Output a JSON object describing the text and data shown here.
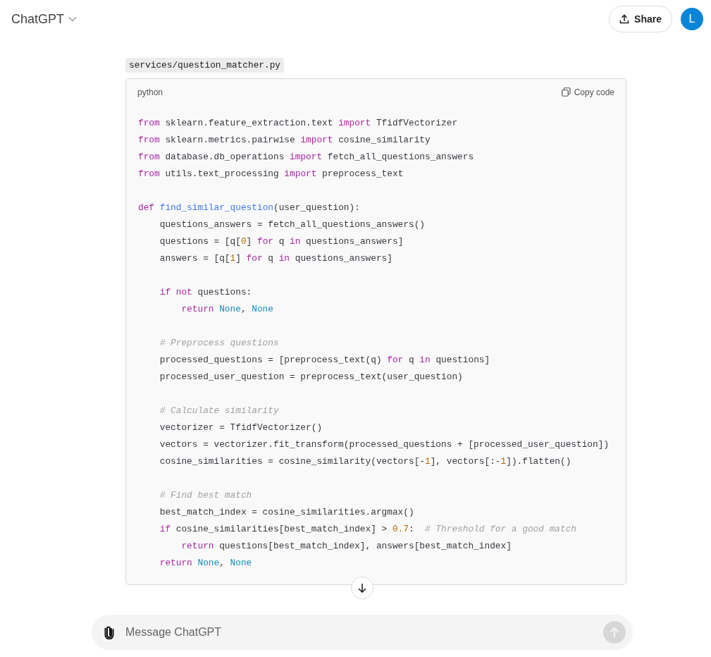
{
  "header": {
    "title": "ChatGPT",
    "share_label": "Share",
    "avatar_letter": "L"
  },
  "file_label": "services/question_matcher.py",
  "code_block": {
    "language": "python",
    "copy_label": "Copy code",
    "lines": [
      {
        "kind": "code",
        "tokens": [
          {
            "kind": "keyword",
            "text": "from"
          },
          {
            "kind": "plain",
            "text": " sklearn.feature_extraction.text "
          },
          {
            "kind": "keyword",
            "text": "import"
          },
          {
            "kind": "plain",
            "text": " TfidfVectorizer"
          }
        ]
      },
      {
        "kind": "code",
        "tokens": [
          {
            "kind": "keyword",
            "text": "from"
          },
          {
            "kind": "plain",
            "text": " sklearn.metrics.pairwise "
          },
          {
            "kind": "keyword",
            "text": "import"
          },
          {
            "kind": "plain",
            "text": " cosine_similarity"
          }
        ]
      },
      {
        "kind": "code",
        "tokens": [
          {
            "kind": "keyword",
            "text": "from"
          },
          {
            "kind": "plain",
            "text": " database.db_operations "
          },
          {
            "kind": "keyword",
            "text": "import"
          },
          {
            "kind": "plain",
            "text": " fetch_all_questions_answers"
          }
        ]
      },
      {
        "kind": "code",
        "tokens": [
          {
            "kind": "keyword",
            "text": "from"
          },
          {
            "kind": "plain",
            "text": " utils.text_processing "
          },
          {
            "kind": "keyword",
            "text": "import"
          },
          {
            "kind": "plain",
            "text": " preprocess_text"
          }
        ]
      },
      {
        "kind": "blank"
      },
      {
        "kind": "code",
        "tokens": [
          {
            "kind": "keyword",
            "text": "def "
          },
          {
            "kind": "function",
            "text": "find_similar_question"
          },
          {
            "kind": "plain",
            "text": "(user_question):"
          }
        ],
        "children": [
          {
            "kind": "code",
            "tokens": [
              {
                "kind": "plain",
                "text": "questions_answers = fetch_all_questions_answers()"
              }
            ]
          },
          {
            "kind": "code",
            "tokens": [
              {
                "kind": "plain",
                "text": "questions = [q["
              },
              {
                "kind": "number",
                "text": "0"
              },
              {
                "kind": "plain",
                "text": "] "
              },
              {
                "kind": "keyword",
                "text": "for"
              },
              {
                "kind": "plain",
                "text": " q "
              },
              {
                "kind": "keyword",
                "text": "in"
              },
              {
                "kind": "plain",
                "text": " questions_answers]"
              }
            ]
          },
          {
            "kind": "code",
            "tokens": [
              {
                "kind": "plain",
                "text": "answers = [q["
              },
              {
                "kind": "number",
                "text": "1"
              },
              {
                "kind": "plain",
                "text": "] "
              },
              {
                "kind": "keyword",
                "text": "for"
              },
              {
                "kind": "plain",
                "text": " q "
              },
              {
                "kind": "keyword",
                "text": "in"
              },
              {
                "kind": "plain",
                "text": " questions_answers]"
              }
            ]
          },
          {
            "kind": "blank"
          },
          {
            "kind": "code",
            "tokens": [
              {
                "kind": "keyword",
                "text": "if not"
              },
              {
                "kind": "plain",
                "text": " questions:"
              }
            ],
            "children": [
              {
                "kind": "code",
                "tokens": [
                  {
                    "kind": "keyword",
                    "text": "return "
                  },
                  {
                    "kind": "constant",
                    "text": "None"
                  },
                  {
                    "kind": "plain",
                    "text": ", "
                  },
                  {
                    "kind": "constant",
                    "text": "None"
                  }
                ]
              }
            ]
          },
          {
            "kind": "blank"
          },
          {
            "kind": "code",
            "tokens": [
              {
                "kind": "comment",
                "text": "# Preprocess questions"
              }
            ]
          },
          {
            "kind": "code",
            "tokens": [
              {
                "kind": "plain",
                "text": "processed_questions = [preprocess_text(q) "
              },
              {
                "kind": "keyword",
                "text": "for"
              },
              {
                "kind": "plain",
                "text": " q "
              },
              {
                "kind": "keyword",
                "text": "in"
              },
              {
                "kind": "plain",
                "text": " questions]"
              }
            ]
          },
          {
            "kind": "code",
            "tokens": [
              {
                "kind": "plain",
                "text": "processed_user_question = preprocess_text(user_question)"
              }
            ]
          },
          {
            "kind": "blank"
          },
          {
            "kind": "code",
            "tokens": [
              {
                "kind": "comment",
                "text": "# Calculate similarity"
              }
            ]
          },
          {
            "kind": "code",
            "tokens": [
              {
                "kind": "plain",
                "text": "vectorizer = TfidfVectorizer()"
              }
            ]
          },
          {
            "kind": "code",
            "tokens": [
              {
                "kind": "plain",
                "text": "vectors = vectorizer.fit_transform(processed_questions + [processed_user_question])"
              }
            ]
          },
          {
            "kind": "code",
            "tokens": [
              {
                "kind": "plain",
                "text": "cosine_similarities = cosine_similarity(vectors[-"
              },
              {
                "kind": "number",
                "text": "1"
              },
              {
                "kind": "plain",
                "text": "], vectors[:-"
              },
              {
                "kind": "number",
                "text": "1"
              },
              {
                "kind": "plain",
                "text": "]).flatten()"
              }
            ]
          },
          {
            "kind": "blank"
          },
          {
            "kind": "code",
            "tokens": [
              {
                "kind": "comment",
                "text": "# Find best match"
              }
            ]
          },
          {
            "kind": "code",
            "tokens": [
              {
                "kind": "plain",
                "text": "best_match_index = cosine_similarities.argmax()"
              }
            ]
          },
          {
            "kind": "code",
            "tokens": [
              {
                "kind": "keyword",
                "text": "if"
              },
              {
                "kind": "plain",
                "text": " cosine_similarities[best_match_index] > "
              },
              {
                "kind": "number",
                "text": "0.7"
              },
              {
                "kind": "plain",
                "text": ":  "
              },
              {
                "kind": "comment",
                "text": "# Threshold for a good match"
              }
            ],
            "children": [
              {
                "kind": "code",
                "tokens": [
                  {
                    "kind": "keyword",
                    "text": "return"
                  },
                  {
                    "kind": "plain",
                    "text": " questions[best_match_index], answers[best_match_index]"
                  }
                ]
              }
            ]
          },
          {
            "kind": "code",
            "tokens": [
              {
                "kind": "keyword",
                "text": "return "
              },
              {
                "kind": "constant",
                "text": "None"
              },
              {
                "kind": "plain",
                "text": ", "
              },
              {
                "kind": "constant",
                "text": "None"
              }
            ]
          }
        ]
      }
    ]
  },
  "composer": {
    "placeholder": "Message ChatGPT"
  }
}
